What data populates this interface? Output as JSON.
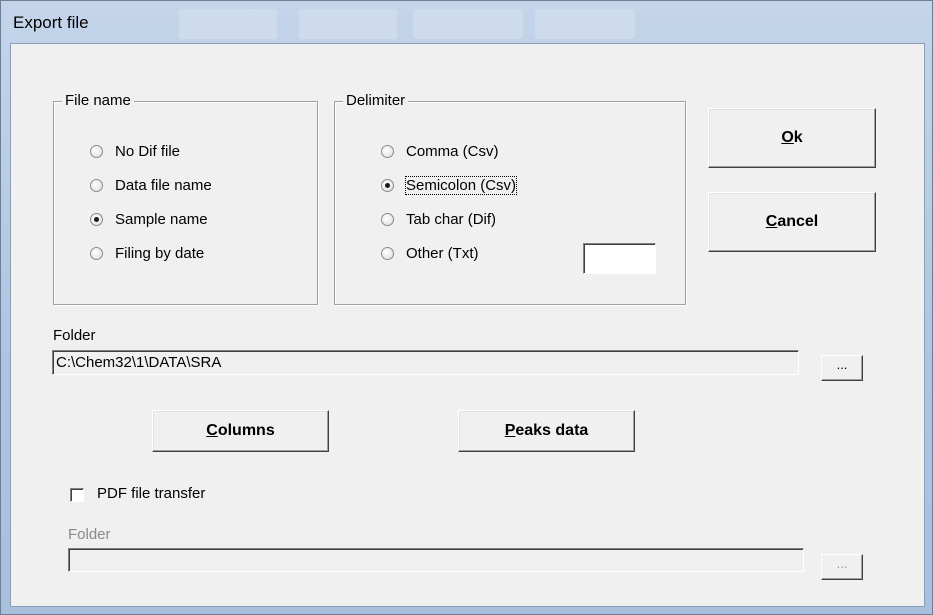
{
  "window": {
    "title": "Export file"
  },
  "file_name_group": {
    "legend": "File name",
    "options": [
      {
        "label": "No Dif file",
        "selected": false
      },
      {
        "label": "Data file name",
        "selected": false
      },
      {
        "label": "Sample name",
        "selected": true
      },
      {
        "label": "Filing by date",
        "selected": false
      }
    ]
  },
  "delimiter_group": {
    "legend": "Delimiter",
    "options": [
      {
        "label": "Comma (Csv)",
        "selected": false
      },
      {
        "label": "Semicolon (Csv)",
        "selected": true
      },
      {
        "label": "Tab char (Dif)",
        "selected": false
      },
      {
        "label": "Other (Txt)",
        "selected": false
      }
    ],
    "other_value": ""
  },
  "buttons": {
    "ok_mnemonic": "O",
    "ok_rest": "k",
    "cancel_mnemonic": "C",
    "cancel_rest": "ancel",
    "columns_mnemonic": "C",
    "columns_rest": "olumns",
    "peaks_mnemonic": "P",
    "peaks_rest": "eaks data"
  },
  "folder": {
    "label": "Folder",
    "value": "C:\\Chem32\\1\\DATA\\SRA",
    "browse_label": "..."
  },
  "pdf": {
    "checkbox_label": "PDF file transfer",
    "checked": false,
    "folder_label": "Folder",
    "folder_value": "",
    "browse_label": "..."
  }
}
